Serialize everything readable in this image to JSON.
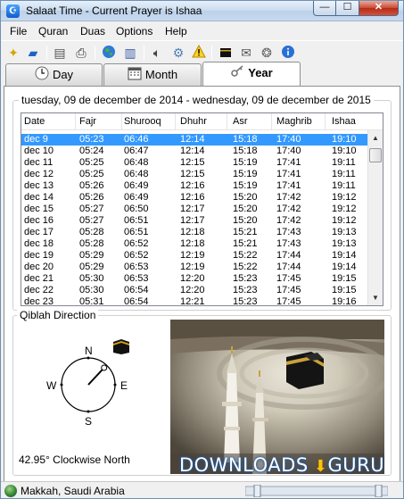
{
  "window": {
    "title": "Salaat Time - Current Prayer is Ishaa",
    "min_glyph": "—",
    "max_glyph": "☐",
    "close_glyph": "✕"
  },
  "menu": [
    "File",
    "Quran",
    "Duas",
    "Options",
    "Help"
  ],
  "toolbar": {
    "icons": [
      "lamp-icon",
      "book-icon",
      "document-icon",
      "printer-icon",
      "globe-icon",
      "notepad-icon",
      "speaker-icon",
      "settings-icon",
      "warning-icon",
      "kaaba-icon",
      "wallet-icon",
      "gears-icon",
      "info-icon"
    ]
  },
  "tabs": [
    {
      "label": "Day",
      "icon": "clock-icon"
    },
    {
      "label": "Month",
      "icon": "calendar-icon"
    },
    {
      "label": "Year",
      "icon": "key-icon",
      "active": true
    }
  ],
  "year_view": {
    "range": "tuesday, 09 de december de 2014 - wednesday, 09 de december de 2015",
    "columns": [
      "Date",
      "Fajr",
      "Shurooq",
      "Dhuhr",
      "Asr",
      "Maghrib",
      "Ishaa"
    ],
    "rows": [
      [
        "dec 9",
        "05:23",
        "06:46",
        "12:14",
        "15:18",
        "17:40",
        "19:10"
      ],
      [
        "dec 10",
        "05:24",
        "06:47",
        "12:14",
        "15:18",
        "17:40",
        "19:10"
      ],
      [
        "dec 11",
        "05:25",
        "06:48",
        "12:15",
        "15:19",
        "17:41",
        "19:11"
      ],
      [
        "dec 12",
        "05:25",
        "06:48",
        "12:15",
        "15:19",
        "17:41",
        "19:11"
      ],
      [
        "dec 13",
        "05:26",
        "06:49",
        "12:16",
        "15:19",
        "17:41",
        "19:11"
      ],
      [
        "dec 14",
        "05:26",
        "06:49",
        "12:16",
        "15:20",
        "17:42",
        "19:12"
      ],
      [
        "dec 15",
        "05:27",
        "06:50",
        "12:17",
        "15:20",
        "17:42",
        "19:12"
      ],
      [
        "dec 16",
        "05:27",
        "06:51",
        "12:17",
        "15:20",
        "17:42",
        "19:12"
      ],
      [
        "dec 17",
        "05:28",
        "06:51",
        "12:18",
        "15:21",
        "17:43",
        "19:13"
      ],
      [
        "dec 18",
        "05:28",
        "06:52",
        "12:18",
        "15:21",
        "17:43",
        "19:13"
      ],
      [
        "dec 19",
        "05:29",
        "06:52",
        "12:19",
        "15:22",
        "17:44",
        "19:14"
      ],
      [
        "dec 20",
        "05:29",
        "06:53",
        "12:19",
        "15:22",
        "17:44",
        "19:14"
      ],
      [
        "dec 21",
        "05:30",
        "06:53",
        "12:20",
        "15:23",
        "17:45",
        "19:15"
      ],
      [
        "dec 22",
        "05:30",
        "06:54",
        "12:20",
        "15:23",
        "17:45",
        "19:15"
      ],
      [
        "dec 23",
        "05:31",
        "06:54",
        "12:21",
        "15:23",
        "17:45",
        "19:16"
      ]
    ],
    "selected_row": 0
  },
  "qiblah": {
    "title": "Qiblah Direction",
    "compass": {
      "n": "N",
      "s": "S",
      "e": "E",
      "w": "W"
    },
    "bearing_deg": 42.95,
    "label": "42.95° Clockwise North"
  },
  "status": {
    "location": "Makkah, Saudi Arabia"
  },
  "watermark": {
    "text": "DOWNLOADS",
    "suffix": "GURU"
  },
  "colors": {
    "selection": "#3399ff",
    "title_gradient": "#c9dbee",
    "close_button": "#c84a35"
  }
}
